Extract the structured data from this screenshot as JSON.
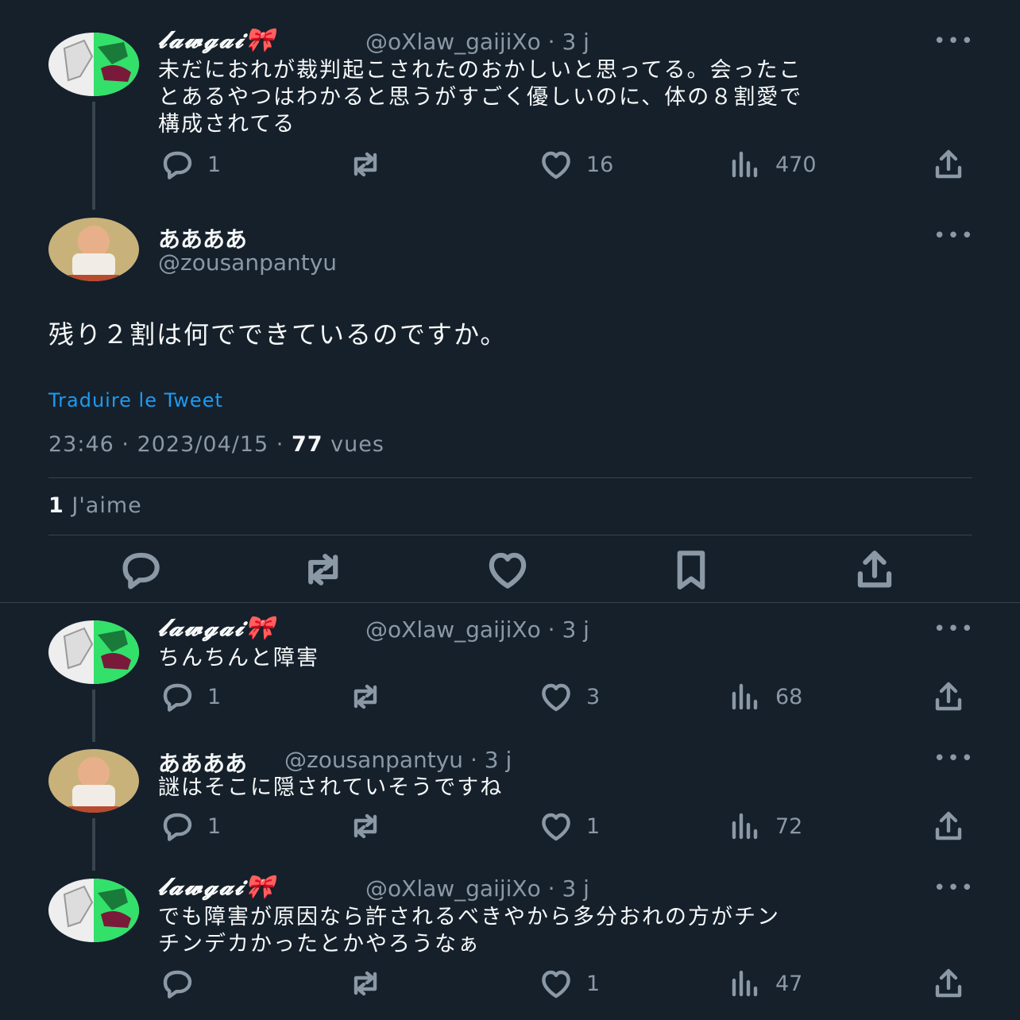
{
  "posts": [
    {
      "name": "𝓵𝓪𝔀𝓰𝓪𝓲🎀",
      "handle": "@oXlaw_gaijiXo",
      "time": "· 3 j",
      "text_lines": [
        "未だにおれが裁判起こされたのおかしいと思ってる。会ったこ",
        "とあるやつはわかると思うがすごく優しいのに、体の８割愛で",
        "構成されてる"
      ],
      "replies": "1",
      "likes": "16",
      "views": "470"
    },
    {
      "name": "ああああ",
      "handle": "@zousanpantyu",
      "text": "残り２割は何でできているのですか。",
      "translate": "Traduire le Tweet",
      "time": "23:46",
      "date": "2023/04/15",
      "views_count": "77",
      "views_label": "vues",
      "likes_count": "1",
      "likes_label": "J'aime"
    },
    {
      "name": "𝓵𝓪𝔀𝓰𝓪𝓲🎀",
      "handle": "@oXlaw_gaijiXo",
      "time": "· 3 j",
      "text_lines": [
        "ちんちんと障害"
      ],
      "replies": "1",
      "likes": "3",
      "views": "68"
    },
    {
      "name": "ああああ",
      "handle": "@zousanpantyu",
      "time": "· 3 j",
      "text_lines": [
        "謎はそこに隠されていそうですね"
      ],
      "replies": "1",
      "likes": "1",
      "views": "72"
    },
    {
      "name": "𝓵𝓪𝔀𝓰𝓪𝓲🎀",
      "handle": "@oXlaw_gaijiXo",
      "time": "· 3 j",
      "text_lines": [
        "でも障害が原因なら許されるべきやから多分おれの方がチン",
        "チンデカかったとかやろうなぁ"
      ],
      "likes": "1",
      "views": "47"
    }
  ],
  "more_glyph": "•••",
  "colors": {
    "background": "#15202b",
    "text": "#f7f9f9",
    "muted": "#8b98a5",
    "link": "#1d9bf0",
    "border": "#38444d",
    "avatar_green": "#33e06a"
  }
}
